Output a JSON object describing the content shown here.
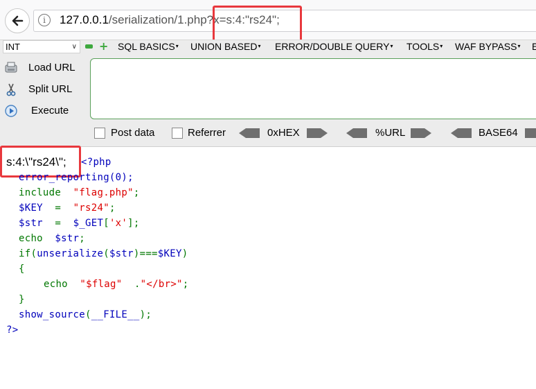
{
  "browser": {
    "url_host": "127.0.0.1",
    "url_path": "/serialization/1.php?x=s:4:\"rs24\";"
  },
  "hackbar": {
    "type_select": "INT",
    "menus": [
      "SQL BASICS",
      "UNION BASED",
      "ERROR/DOUBLE QUERY",
      "TOOLS",
      "WAF BYPASS",
      "E"
    ],
    "load_url": "Load URL",
    "split_url": "Split URL",
    "execute": "Execute",
    "post_data": "Post data",
    "referrer": "Referrer",
    "hex": "0xHEX",
    "url_enc": "%URL",
    "base64": "BASE64"
  },
  "page": {
    "echo_output": "s:4:\\\"rs24\\\";",
    "code_lines": [
      "<?php",
      "error_reporting(0);",
      "include  \"flag.php\";",
      "$KEY  =  \"rs24\";",
      "$str  =  $_GET['x'];",
      "echo  $str;",
      "if(unserialize($str)===$KEY)",
      "{",
      "echo  \"$flag\"  .\"</br>\";",
      "}",
      "show_source(__FILE__);",
      "?>"
    ]
  },
  "colors": {
    "code_green": "#007700",
    "code_blue": "#0000bb",
    "code_red": "#dd0000",
    "highlight_box": "#e8383d"
  }
}
